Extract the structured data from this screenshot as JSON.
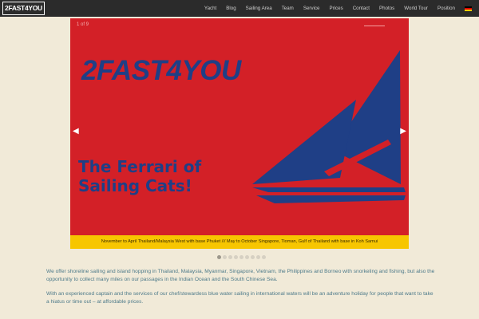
{
  "header": {
    "logo": "2FAST4YOU",
    "nav": [
      "Yacht",
      "Blog",
      "Sailing Area",
      "Team",
      "Service",
      "Prices",
      "Contact",
      "Photos",
      "World Tour",
      "Position"
    ],
    "language_flag_icon": "german-flag-icon"
  },
  "slider": {
    "counter": "1 of 9",
    "brand": "2FAST4YOU",
    "tagline_line1": "The Ferrari of",
    "tagline_line2": "Sailing Cats!",
    "caption": "November to April Thailand/Malaysia West with base Phuket /// May to October Singapore, Tioman, Gulf of Thailand with base in Koh Samui",
    "prev_icon": "chevron-left-icon",
    "next_icon": "chevron-right-icon",
    "slide_count": 9,
    "active_slide": 1,
    "colors": {
      "background": "#d32027",
      "brand": "#1f3f86",
      "caption_bar": "#f7c600"
    }
  },
  "content": {
    "paragraph1": "We offer shoreline sailing and island hopping in Thailand, Malaysia, Myanmar, Singapore, Vietnam, the Philippines and Borneo with snorkeling and fishing, but also the opportunity to collect many miles on our passages in the Indian Ocean and the South Chinese Sea.",
    "paragraph2": "With an experienced captain and the services of our chef/stewardess blue water sailing in international waters will be an adventure holiday for people that want to take a hiatus or time out – at affordable prices."
  },
  "colors": {
    "page_background": "#f1ead8",
    "topbar": "#2b2b2b",
    "text": "#4d7a8a"
  }
}
